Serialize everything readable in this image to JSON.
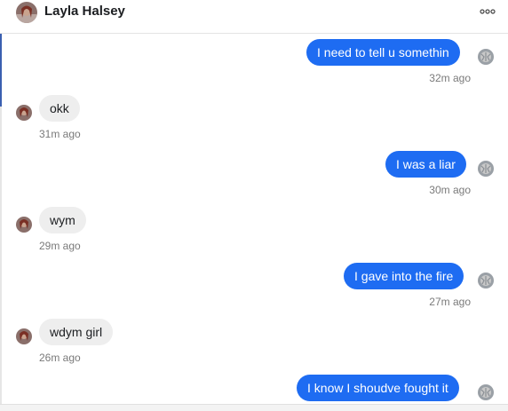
{
  "header": {
    "contact_name": "Layla Halsey",
    "more_icon": "more-options-icon"
  },
  "messages": [
    {
      "direction": "out",
      "text": "I need to tell u somethin",
      "time": "32m ago"
    },
    {
      "direction": "in",
      "text": "okk",
      "time": "31m ago"
    },
    {
      "direction": "out",
      "text": "I was a liar",
      "time": "30m ago"
    },
    {
      "direction": "in",
      "text": "wym",
      "time": "29m ago"
    },
    {
      "direction": "out",
      "text": "I gave into the fire",
      "time": "27m ago"
    },
    {
      "direction": "in",
      "text": "wdym girl",
      "time": "26m ago"
    },
    {
      "direction": "out",
      "text": "I know I shoudve fought it",
      "time": ""
    }
  ],
  "colors": {
    "outgoing_bubble": "#1e6cf2",
    "incoming_bubble": "#eeeeee",
    "timestamp": "#7a7a7a"
  }
}
